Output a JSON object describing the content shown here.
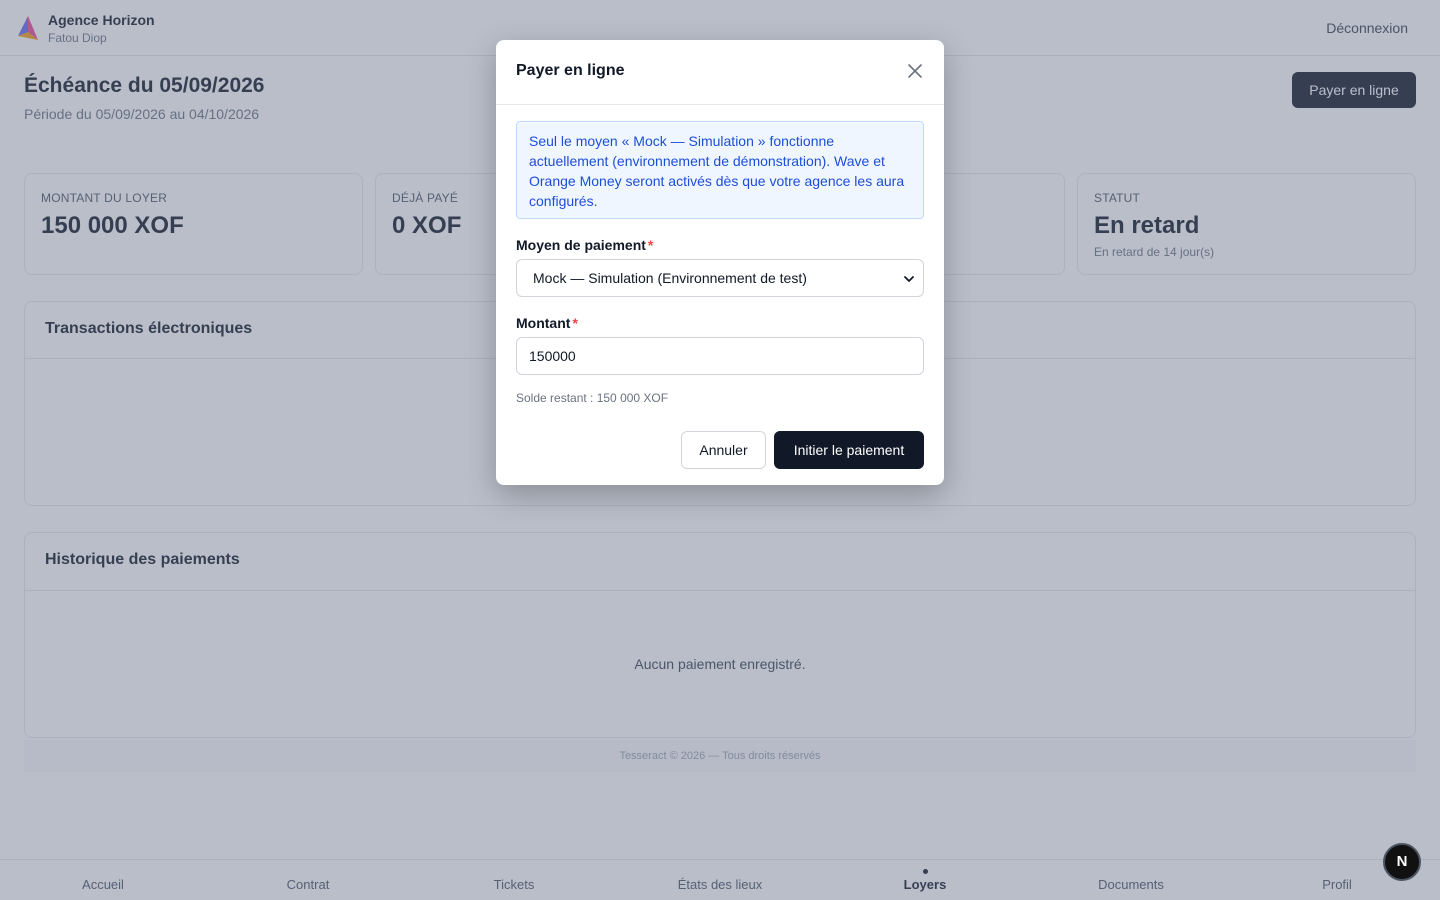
{
  "header": {
    "agency_name": "Agence Horizon",
    "user_name": "Fatou Diop",
    "logout_label": "Déconnexion"
  },
  "page": {
    "title": "Échéance du 05/09/2026",
    "subtitle": "Période du 05/09/2026 au 04/10/2026",
    "pay_button_label": "Payer en ligne"
  },
  "stats": [
    {
      "label": "MONTANT DU LOYER",
      "value": "150 000 XOF"
    },
    {
      "label": "DÉJÀ PAYÉ",
      "value": "0 XOF"
    },
    {
      "label": "STATUT",
      "value": "En retard",
      "sub": "En retard de 14 jour(s)"
    }
  ],
  "sections": {
    "transactions_title": "Transactions électroniques",
    "history_title": "Historique des paiements",
    "history_empty": "Aucun paiement enregistré."
  },
  "footer": {
    "text": "Tesseract © 2026 — Tous droits réservés"
  },
  "bottom_nav": {
    "items": [
      {
        "label": "Accueil"
      },
      {
        "label": "Contrat"
      },
      {
        "label": "Tickets"
      },
      {
        "label": "États des lieux"
      },
      {
        "label": "Loyers"
      },
      {
        "label": "Documents"
      },
      {
        "label": "Profil"
      }
    ],
    "active": "Loyers"
  },
  "nextjs_badge": "N",
  "modal": {
    "title": "Payer en ligne",
    "info_text": "Seul le moyen « Mock — Simulation » fonctionne actuellement (environnement de démonstration). Wave et Orange Money seront activés dès que votre agence les aura configurés.",
    "method_label": "Moyen de paiement",
    "required_mark": "*",
    "method_selected": "Mock — Simulation (Environnement de test)",
    "amount_label": "Montant",
    "amount_value": "150000",
    "balance_text": "Solde restant : 150 000 XOF",
    "cancel_label": "Annuler",
    "submit_label": "Initier le paiement"
  },
  "colors": {
    "primary": "#111827",
    "info_bg": "#eff6ff",
    "info_text": "#1d4ed8",
    "required": "#ef4444",
    "overlay": "rgba(100,110,135,0.45)"
  },
  "icons": {
    "logo": "agency-logo-icon",
    "close": "close-icon",
    "select": "chevron-down-icon"
  }
}
